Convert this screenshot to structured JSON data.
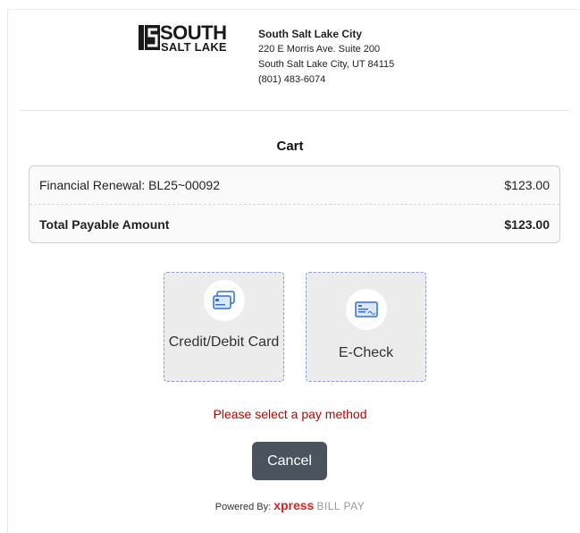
{
  "header": {
    "logo": {
      "line1": "SOUTH",
      "line2": "SALT LAKE"
    },
    "address": {
      "name": "South Salt Lake City",
      "street": "220 E Morris Ave. Suite 200",
      "city": "South Salt Lake City, UT 84115",
      "phone": "(801) 483-6074"
    }
  },
  "cart": {
    "title": "Cart",
    "items": [
      {
        "label": "Financial Renewal: BL25~00092",
        "amount": "$123.00"
      }
    ],
    "total": {
      "label": "Total Payable Amount",
      "amount": "$123.00"
    }
  },
  "pay_methods": {
    "credit": {
      "label": "Credit/Debit Card",
      "icon": "credit-card-icon"
    },
    "echeck": {
      "label": "E-Check",
      "icon": "check-icon"
    }
  },
  "error_message": "Please select a pay method",
  "cancel_label": "Cancel",
  "footer": {
    "prefix": "Powered By:",
    "brand": "xpress",
    "suffix": "BILL PAY"
  },
  "colors": {
    "error": "#c00000",
    "cancel_bg": "#4a545e",
    "brand": "#e0201f",
    "icon_blue": "#2f6fd6"
  }
}
